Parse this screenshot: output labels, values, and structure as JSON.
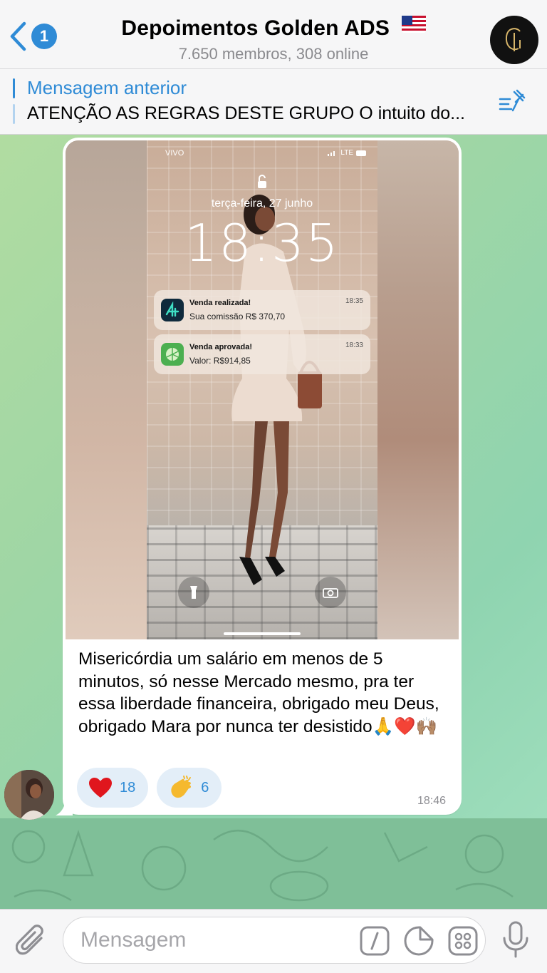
{
  "header": {
    "back_badge": "1",
    "title": "Depoimentos Golden ADS",
    "subtitle": "7.650 membros, 308 online"
  },
  "pinned": {
    "title": "Mensagem anterior",
    "text": "ATENÇÃO AS REGRAS DESTE GRUPO O intuito do..."
  },
  "message": {
    "media": {
      "carrier": "VIVO",
      "network": "LTE",
      "date": "terça-feira, 27 junho",
      "time": "18:35",
      "notifications": [
        {
          "title": "Venda realizada!",
          "body": "Sua comissão R$ 370,70",
          "time": "18:35",
          "color": "#0f2a3c"
        },
        {
          "title": "Venda aprovada!",
          "body": "Valor: R$914,85",
          "time": "18:33",
          "color": "#4caf50"
        }
      ]
    },
    "text": "Misericórdia um salário em menos de 5 minutos, só nesse Mercado mesmo, pra ter essa liberdade financeira, obrigado meu Deus, obrigado Mara por nunca ter desistido🙏❤️🙌🏽",
    "reactions": [
      {
        "emoji": "❤️",
        "count": "18"
      },
      {
        "emoji": "👏",
        "count": "6"
      }
    ],
    "time": "18:46"
  },
  "input": {
    "placeholder": "Mensagem"
  },
  "colors": {
    "accent": "#2f8bd6",
    "reaction_bg": "#e3eef8"
  }
}
